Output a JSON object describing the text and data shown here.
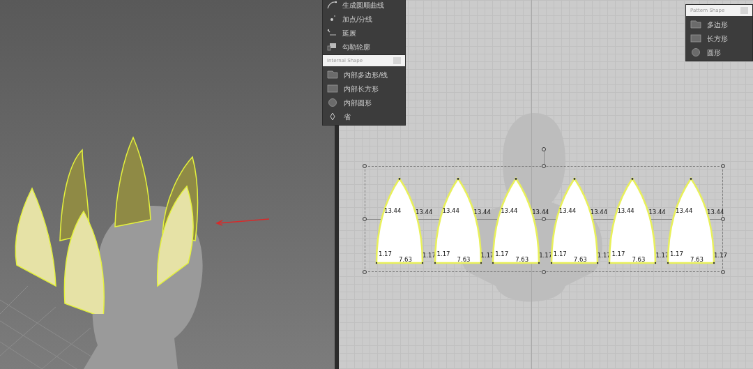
{
  "edit_menu": {
    "items": [
      {
        "label": "生成圆顺曲线"
      },
      {
        "label": "加点/分线"
      },
      {
        "label": "延展"
      },
      {
        "label": "勾勒轮廓"
      }
    ]
  },
  "internal_shape_panel": {
    "title": "Internal Shape",
    "items": [
      {
        "label": "内部多边形/线"
      },
      {
        "label": "内部长方形"
      },
      {
        "label": "内部圆形"
      },
      {
        "label": "省"
      }
    ]
  },
  "pattern_shape_panel": {
    "title": "Pattern Shape",
    "items": [
      {
        "label": "多边形"
      },
      {
        "label": "长方形"
      },
      {
        "label": "圆形"
      }
    ]
  },
  "pattern_pieces": [
    {
      "left_edge": "13.44",
      "right_edge": "13.44",
      "left_corner": "1.17",
      "right_corner": "1.17",
      "bottom_edge": "7.63"
    },
    {
      "left_edge": "13.44",
      "right_edge": "13.44",
      "left_corner": "1.17",
      "right_corner": "1.17",
      "bottom_edge": "7.63"
    },
    {
      "left_edge": "13.44",
      "right_edge": "13.44",
      "left_corner": "1.17",
      "right_corner": "1.17",
      "bottom_edge": "7.63"
    },
    {
      "left_edge": "13.44",
      "right_edge": "13.44",
      "left_corner": "1.17",
      "right_corner": "1.17",
      "bottom_edge": "7.63"
    },
    {
      "left_edge": "13.44",
      "right_edge": "13.44",
      "left_corner": "1.17",
      "right_corner": "1.17",
      "bottom_edge": "7.63"
    },
    {
      "left_edge": "13.44",
      "right_edge": "13.44",
      "left_corner": "1.17",
      "right_corner": "1.17",
      "bottom_edge": "7.63"
    }
  ]
}
